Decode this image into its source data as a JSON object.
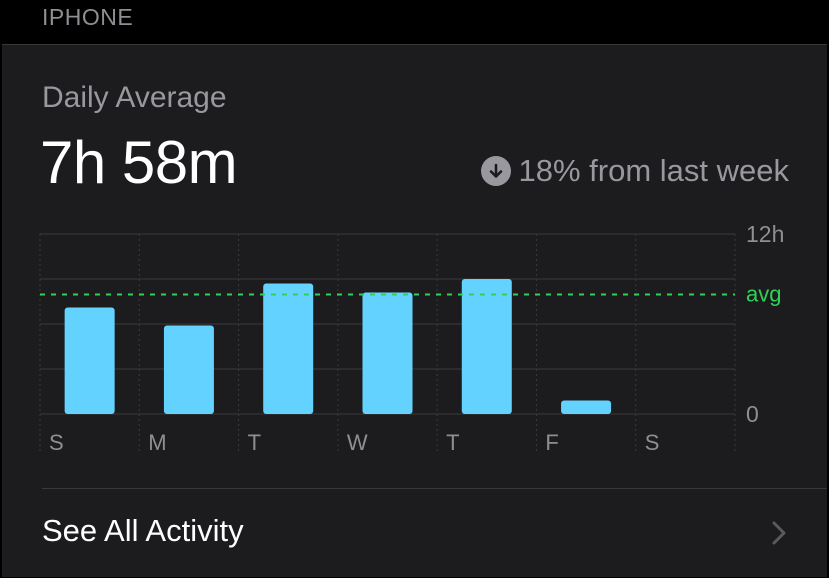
{
  "section": {
    "title": "IPHONE"
  },
  "summary": {
    "label": "Daily Average",
    "value": "7h 58m",
    "change_text": "18% from last week",
    "change_direction_icon": "arrow-down-circle-icon"
  },
  "footer": {
    "link_label": "See All Activity",
    "chevron_icon": "chevron-right-icon"
  },
  "colors": {
    "bar": "#64d2ff",
    "avg_line": "#30d158",
    "grid": "#3a3a3c",
    "muted": "#8e8e93"
  },
  "chart_data": {
    "type": "bar",
    "categories": [
      "S",
      "M",
      "T",
      "W",
      "T",
      "F",
      "S"
    ],
    "values": [
      7.1,
      5.9,
      8.7,
      8.1,
      9.0,
      0.9,
      0
    ],
    "avg": 7.97,
    "avg_label": "avg",
    "ylim": [
      0,
      12
    ],
    "y_tick_labels": [
      "12h",
      "0"
    ],
    "grid": true
  }
}
